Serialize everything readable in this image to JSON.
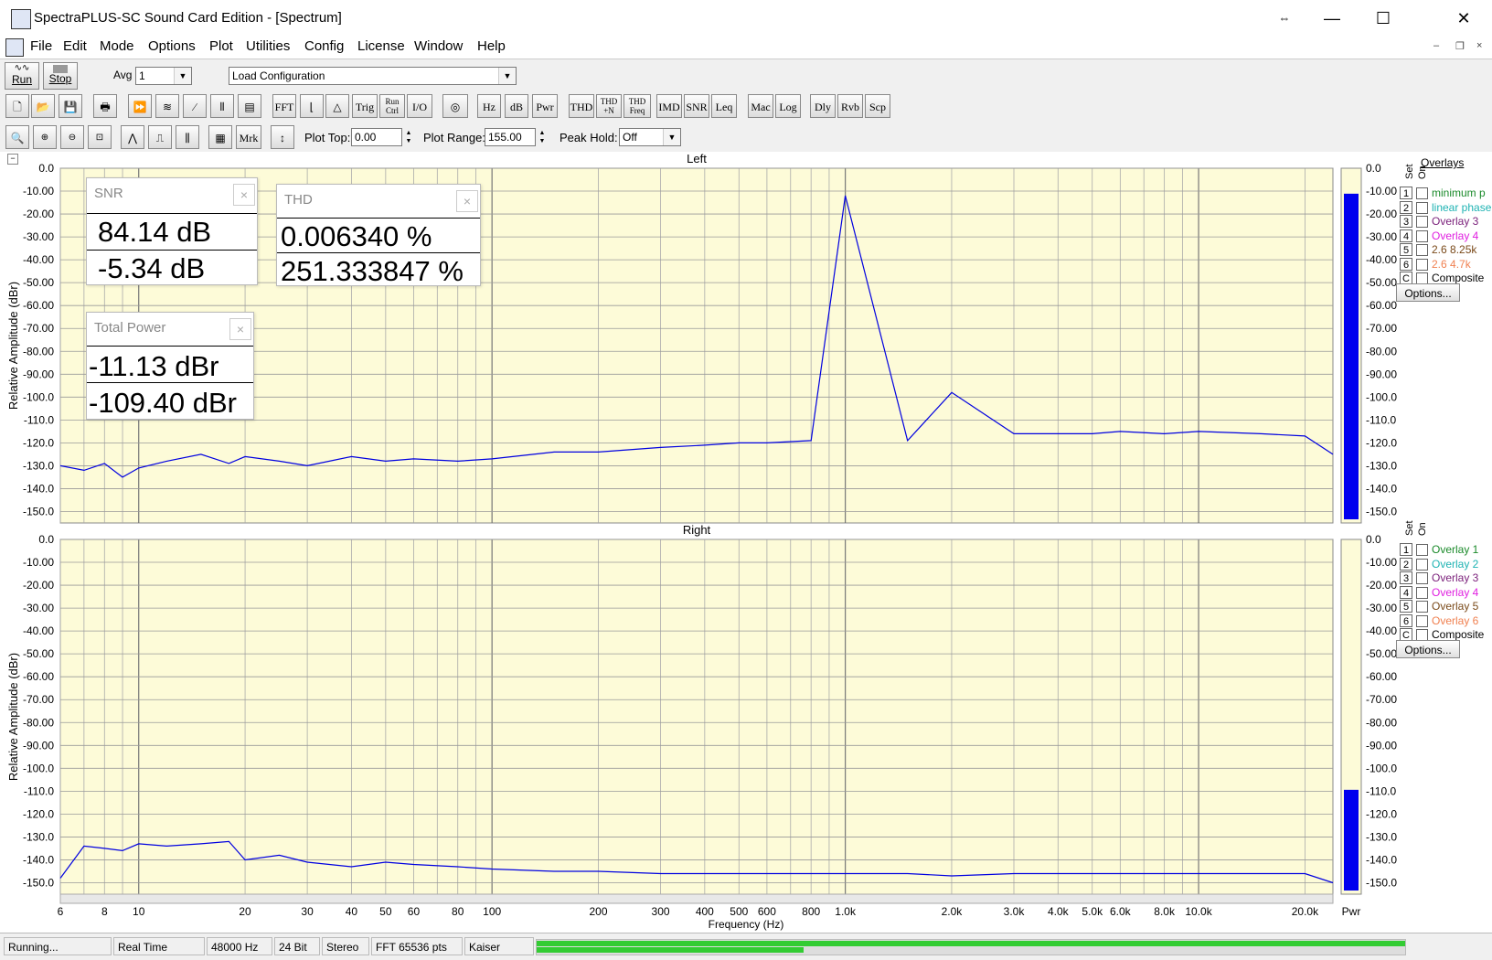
{
  "window": {
    "title": "SpectraPLUS-SC Sound Card Edition - [Spectrum]",
    "controls": [
      "⇔",
      "—",
      "☐",
      "✕"
    ],
    "mdi_controls": [
      "–",
      "❐",
      "×"
    ]
  },
  "menu": [
    "File",
    "Edit",
    "Mode",
    "Options",
    "Plot",
    "Utilities",
    "Config",
    "License",
    "Window",
    "Help"
  ],
  "toolbar1": {
    "run_label": "Run",
    "stop_label": "Stop",
    "avg_label": "Avg",
    "avg_value": "1",
    "config_value": "Load Configuration"
  },
  "toolbar2": {
    "text_buttons": [
      "FFT",
      "Trig",
      "Run Ctrl",
      "I/O",
      "Hz",
      "dB",
      "Pwr",
      "THD",
      "THD +N",
      "THD Freq",
      "IMD",
      "SNR",
      "Leq",
      "Mac",
      "Log",
      "Dly",
      "Rvb",
      "Scp"
    ]
  },
  "toolbar3": {
    "mrk_label": "Mrk",
    "plot_top_label": "Plot Top:",
    "plot_top_value": "0.00",
    "plot_range_label": "Plot Range:",
    "plot_range_value": "155.00",
    "peak_hold_label": "Peak Hold:",
    "peak_hold_value": "Off"
  },
  "plots": {
    "y_axis_title": "Relative Amplitude (dBr)",
    "x_axis_title": "Frequency (Hz)",
    "y_ticks": [
      "0.0",
      "-10.00",
      "-20.00",
      "-30.00",
      "-40.00",
      "-50.00",
      "-60.00",
      "-70.00",
      "-80.00",
      "-90.00",
      "-100.0",
      "-110.0",
      "-120.0",
      "-130.0",
      "-140.0",
      "-150.0"
    ],
    "x_ticks": [
      "6",
      "8",
      "10",
      "20",
      "30",
      "40",
      "50",
      "60",
      "80",
      "100",
      "200",
      "300",
      "400",
      "500",
      "600",
      "800",
      "1.0k",
      "2.0k",
      "3.0k",
      "4.0k",
      "5.0k",
      "6.0k",
      "8.0k",
      "10.0k",
      "20.0k"
    ],
    "pwr_label": "Pwr",
    "left_title": "Left",
    "right_title": "Right",
    "overlays_header": "Overlays",
    "set_label": "Set",
    "on_label": "On",
    "options_label": "Options...",
    "left_overlays": [
      {
        "num": "1",
        "name": "minimum p",
        "color": "#1a8a2a"
      },
      {
        "num": "2",
        "name": "linear phase",
        "color": "#1fb3b3"
      },
      {
        "num": "3",
        "name": "Overlay 3",
        "color": "#7a1f7a"
      },
      {
        "num": "4",
        "name": "Overlay 4",
        "color": "#e020e0"
      },
      {
        "num": "5",
        "name": "2.6 8.25k",
        "color": "#7a4a1a"
      },
      {
        "num": "6",
        "name": "2.6 4.7k",
        "color": "#f08050"
      },
      {
        "num": "C",
        "name": "Composite",
        "color": "#000000"
      }
    ],
    "right_overlays": [
      {
        "num": "1",
        "name": "Overlay 1",
        "color": "#1a8a2a"
      },
      {
        "num": "2",
        "name": "Overlay 2",
        "color": "#1fb3b3"
      },
      {
        "num": "3",
        "name": "Overlay 3",
        "color": "#7a1f7a"
      },
      {
        "num": "4",
        "name": "Overlay 4",
        "color": "#e020e0"
      },
      {
        "num": "5",
        "name": "Overlay 5",
        "color": "#7a4a1a"
      },
      {
        "num": "6",
        "name": "Overlay 6",
        "color": "#f08050"
      },
      {
        "num": "C",
        "name": "Composite",
        "color": "#000000"
      }
    ]
  },
  "readouts": {
    "snr": {
      "title": "SNR",
      "value1": "84.14 dB",
      "value2": "-5.34 dB"
    },
    "thd": {
      "title": "THD",
      "value1": "0.006340 %",
      "value2": "251.333847 %"
    },
    "total_power": {
      "title": "Total Power",
      "value1": "-11.13 dBr",
      "value2": "-109.40 dBr"
    }
  },
  "status": {
    "state": "Running...",
    "mode": "Real Time",
    "rate": "48000 Hz",
    "bits": "24 Bit",
    "channels": "Stereo",
    "fft": "FFT 65536 pts",
    "window": "Kaiser"
  },
  "chart_data": [
    {
      "type": "line",
      "title": "Left",
      "xlabel": "Frequency (Hz)",
      "ylabel": "Relative Amplitude (dBr)",
      "x_scale": "log",
      "xlim": [
        6,
        24000
      ],
      "ylim": [
        -155,
        0
      ],
      "power_meter_dBr": -11.13,
      "series": [
        {
          "color": "#0000e0",
          "x": [
            6,
            7,
            8,
            9,
            10,
            12,
            15,
            18,
            20,
            25,
            30,
            40,
            50,
            60,
            80,
            100,
            150,
            200,
            300,
            400,
            500,
            600,
            800,
            1000,
            1500,
            2000,
            3000,
            4000,
            5000,
            6000,
            8000,
            10000,
            15000,
            20000,
            24000
          ],
          "y": [
            -130,
            -132,
            -129,
            -135,
            -131,
            -128,
            -125,
            -129,
            -126,
            -128,
            -130,
            -126,
            -128,
            -127,
            -128,
            -127,
            -124,
            -124,
            -122,
            -121,
            -120,
            -120,
            -119,
            -12,
            -119,
            -98,
            -116,
            -116,
            -116,
            -115,
            -116,
            -115,
            -116,
            -117,
            -125
          ]
        }
      ]
    },
    {
      "type": "line",
      "title": "Right",
      "xlabel": "Frequency (Hz)",
      "ylabel": "Relative Amplitude (dBr)",
      "x_scale": "log",
      "xlim": [
        6,
        24000
      ],
      "ylim": [
        -155,
        0
      ],
      "power_meter_dBr": -109.4,
      "series": [
        {
          "color": "#0000e0",
          "x": [
            6,
            7,
            8,
            9,
            10,
            12,
            15,
            18,
            20,
            25,
            30,
            40,
            50,
            60,
            80,
            100,
            150,
            200,
            300,
            400,
            500,
            600,
            800,
            1000,
            1500,
            2000,
            3000,
            4000,
            5000,
            6000,
            8000,
            10000,
            15000,
            20000,
            24000
          ],
          "y": [
            -148,
            -134,
            -135,
            -136,
            -133,
            -134,
            -133,
            -132,
            -140,
            -138,
            -141,
            -143,
            -141,
            -142,
            -143,
            -144,
            -145,
            -145,
            -146,
            -146,
            -146,
            -146,
            -146,
            -146,
            -146,
            -147,
            -146,
            -146,
            -146,
            -146,
            -146,
            -146,
            -146,
            -146,
            -150
          ]
        }
      ]
    }
  ]
}
